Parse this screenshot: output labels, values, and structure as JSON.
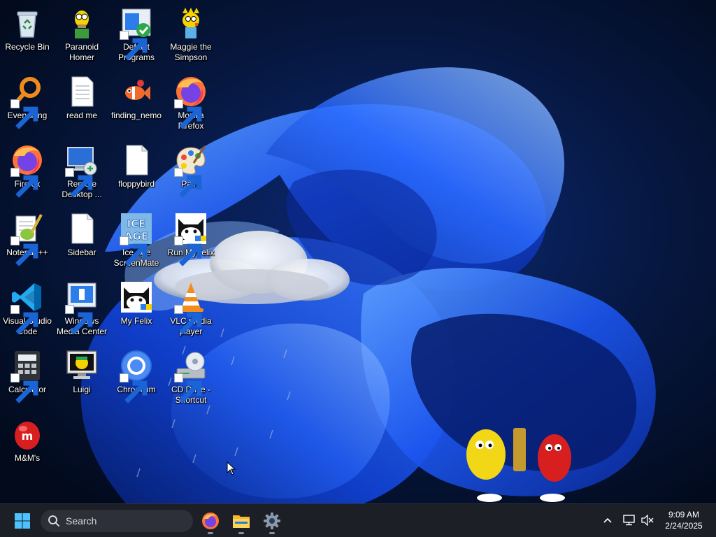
{
  "desktop": {
    "icons": [
      {
        "name": "recycle-bin-icon",
        "label": "Recycle Bin",
        "shortcut": false
      },
      {
        "name": "paranoid-homer-icon",
        "label": "Paranoid\nHomer",
        "shortcut": false
      },
      {
        "name": "default-programs-icon",
        "label": "Default\nPrograms",
        "shortcut": true
      },
      {
        "name": "maggie-simpson-icon",
        "label": "Maggie the\nSimpson",
        "shortcut": false
      },
      {
        "name": "everything-search-icon",
        "label": "Everything",
        "shortcut": true
      },
      {
        "name": "text-document-icon",
        "label": "read me",
        "shortcut": false
      },
      {
        "name": "finding-nemo-icon",
        "label": "finding_nemo",
        "shortcut": false
      },
      {
        "name": "firefox-icon",
        "label": "Mozilla\nFirefox",
        "shortcut": true
      },
      {
        "name": "firefox-icon",
        "label": "Firefox",
        "shortcut": true
      },
      {
        "name": "remote-desktop-icon",
        "label": "Remote\nDesktop ...",
        "shortcut": true
      },
      {
        "name": "blank-file-icon",
        "label": "floppybird",
        "shortcut": false
      },
      {
        "name": "paint-palette-icon",
        "label": "Paint",
        "shortcut": true
      },
      {
        "name": "notepad-plus-plus-icon",
        "label": "Notepad++",
        "shortcut": true
      },
      {
        "name": "blank-file-icon",
        "label": "Sidebar",
        "shortcut": false
      },
      {
        "name": "ice-age-icon",
        "label": "Ice Age\nScreenMate",
        "shortcut": true
      },
      {
        "name": "felix-cat-icon",
        "label": "Run MyFelix",
        "shortcut": true
      },
      {
        "name": "vscode-icon",
        "label": "Visual Studio\nCode",
        "shortcut": true
      },
      {
        "name": "windows-media-center-icon",
        "label": "Windows\nMedia Center",
        "shortcut": true
      },
      {
        "name": "felix-cat-icon",
        "label": "My Felix",
        "shortcut": false
      },
      {
        "name": "vlc-cone-icon",
        "label": "VLC media\nplayer",
        "shortcut": true
      },
      {
        "name": "calculator-icon",
        "label": "Calculator",
        "shortcut": true
      },
      {
        "name": "luigi-monitor-icon",
        "label": "Luigi",
        "shortcut": false
      },
      {
        "name": "chromium-icon",
        "label": "Chromium",
        "shortcut": true
      },
      {
        "name": "cd-drive-icon",
        "label": "CD Drive -\nShortcut",
        "shortcut": true
      },
      {
        "name": "mms-candy-icon",
        "label": "M&M's",
        "shortcut": false
      }
    ]
  },
  "taskbar": {
    "search_placeholder": "Search",
    "pinned_apps": [
      "firefox-icon",
      "file-explorer-icon",
      "settings-gear-icon"
    ],
    "clock_time": "9:09 AM",
    "clock_date": "2/24/2025"
  },
  "colors": {
    "wallpaper_base": "#04112c",
    "wallpaper_accent": "#1d5cff",
    "taskbar": "#1c1f26",
    "search_box": "#2d3038"
  }
}
